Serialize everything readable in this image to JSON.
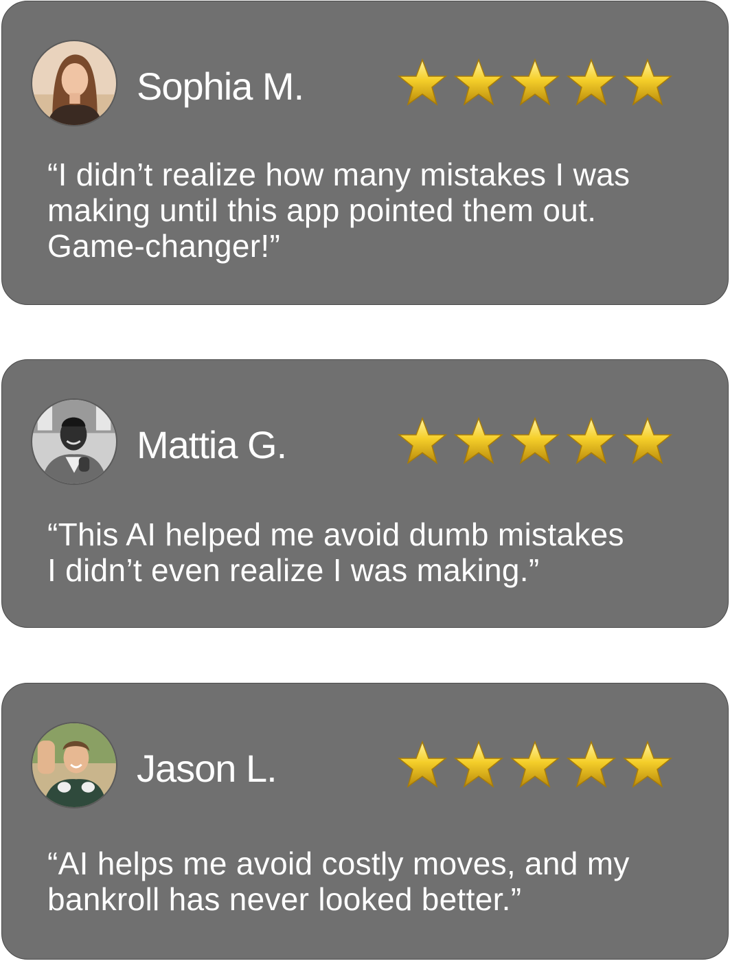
{
  "reviews": [
    {
      "name": "Sophia M.",
      "rating": 5,
      "quote_lines": [
        "“I didn’t realize how many mistakes I was",
        "making until this app pointed them out.",
        "Game-changer!”"
      ],
      "avatar_icon": "woman-portrait-avatar"
    },
    {
      "name": "Mattia G.",
      "rating": 5,
      "quote_lines": [
        "“This AI helped me avoid dumb mistakes",
        "I didn’t even realize I was making.”"
      ],
      "avatar_icon": "man-portrait-avatar"
    },
    {
      "name": "Jason L.",
      "rating": 5,
      "quote_lines": [
        "“AI helps me avoid costly moves, and my",
        "bankroll has never looked better.”"
      ],
      "avatar_icon": "young-man-portrait-avatar"
    }
  ],
  "colors": {
    "card_background": "#707070",
    "text": "#ffffff",
    "star_gold": "#f2c21b"
  }
}
